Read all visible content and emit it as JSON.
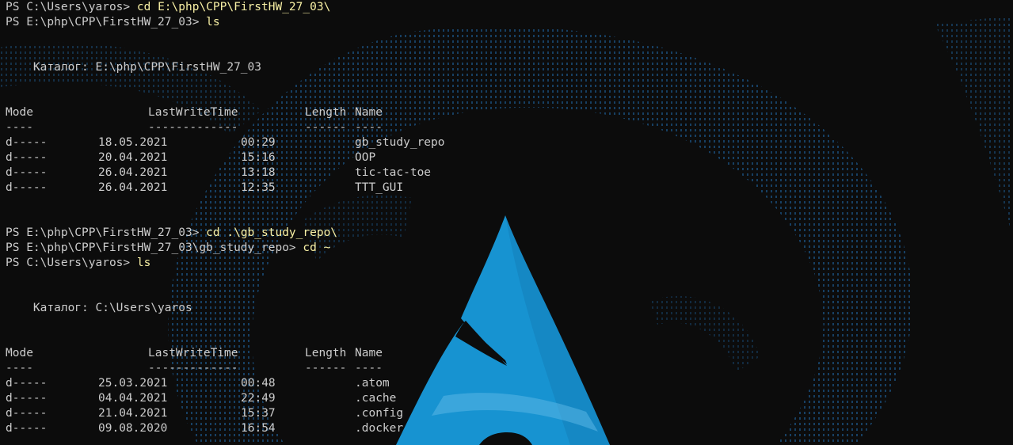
{
  "colors": {
    "background": "#0c0c0c",
    "text": "#cccccc",
    "command": "#f9f1a5",
    "logo_primary": "#1793d1",
    "logo_highlight": "#5ab7e6",
    "pattern": "#1a3a5c"
  },
  "session": {
    "cmd1": {
      "prompt": "PS C:\\Users\\yaros> ",
      "command": "cd E:\\php\\CPP\\FirstHW_27_03\\"
    },
    "cmd2": {
      "prompt": "PS E:\\php\\CPP\\FirstHW_27_03> ",
      "command": "ls"
    },
    "dir1": {
      "label": "    Каталог: E:\\php\\CPP\\FirstHW_27_03",
      "headers": {
        "mode": "Mode",
        "time": "LastWriteTime",
        "length": "Length",
        "name": "Name"
      },
      "underline": {
        "mode": "----",
        "time": "-------------",
        "length": "------",
        "name": "----"
      },
      "rows": [
        {
          "mode": "d-----",
          "date": "18.05.2021",
          "time": "00:29",
          "name": "gb_study_repo"
        },
        {
          "mode": "d-----",
          "date": "20.04.2021",
          "time": "15:16",
          "name": "OOP"
        },
        {
          "mode": "d-----",
          "date": "26.04.2021",
          "time": "13:18",
          "name": "tic-tac-toe"
        },
        {
          "mode": "d-----",
          "date": "26.04.2021",
          "time": "12:35",
          "name": "TTT_GUI"
        }
      ]
    },
    "cmd3": {
      "prompt": "PS E:\\php\\CPP\\FirstHW_27_03> ",
      "command": "cd .\\gb_study_repo\\"
    },
    "cmd4": {
      "prompt": "PS E:\\php\\CPP\\FirstHW_27_03\\gb_study_repo> ",
      "command": "cd ~"
    },
    "cmd5": {
      "prompt": "PS C:\\Users\\yaros> ",
      "command": "ls"
    },
    "dir2": {
      "label": "    Каталог: C:\\Users\\yaros",
      "headers": {
        "mode": "Mode",
        "time": "LastWriteTime",
        "length": "Length",
        "name": "Name"
      },
      "underline": {
        "mode": "----",
        "time": "-------------",
        "length": "------",
        "name": "----"
      },
      "rows": [
        {
          "mode": "d-----",
          "date": "25.03.2021",
          "time": "00:48",
          "name": ".atom"
        },
        {
          "mode": "d-----",
          "date": "04.04.2021",
          "time": "22:49",
          "name": ".cache"
        },
        {
          "mode": "d-----",
          "date": "21.04.2021",
          "time": "15:37",
          "name": ".config"
        },
        {
          "mode": "d-----",
          "date": "09.08.2020",
          "time": "16:54",
          "name": ".docker"
        }
      ]
    }
  },
  "background_icon": "arch-linux-logo-icon"
}
